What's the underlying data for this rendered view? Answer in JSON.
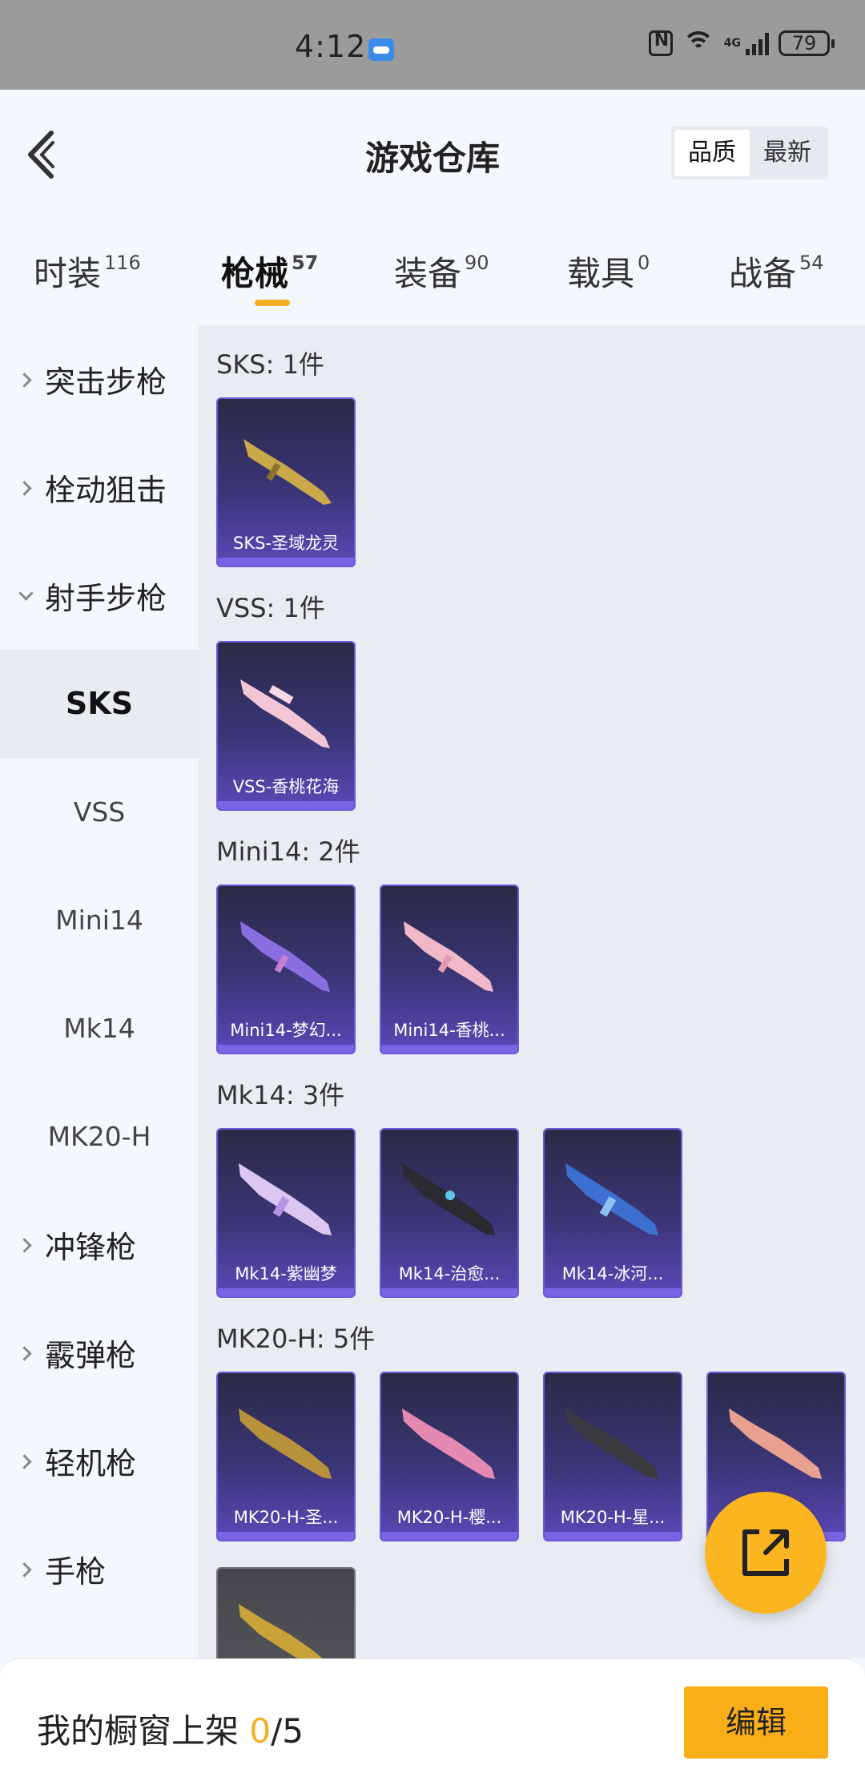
{
  "status_bar": {
    "time": "4:12",
    "network": "4G",
    "battery": "79"
  },
  "header": {
    "title": "游戏仓库",
    "sort_options": [
      "品质",
      "最新"
    ],
    "sort_active": "品质"
  },
  "tabs": [
    {
      "label": "时装",
      "count": "116"
    },
    {
      "label": "枪械",
      "count": "57"
    },
    {
      "label": "装备",
      "count": "90"
    },
    {
      "label": "载具",
      "count": "0"
    },
    {
      "label": "战备",
      "count": "54"
    }
  ],
  "active_tab": "枪械",
  "sidebar": {
    "categories": [
      "突击步枪",
      "栓动狙击",
      "射手步枪",
      "冲锋枪",
      "霰弹枪",
      "轻机枪",
      "手枪"
    ],
    "expanded_category": "射手步枪",
    "subcategories": [
      "SKS",
      "VSS",
      "Mini14",
      "Mk14",
      "MK20-H"
    ],
    "active_subcategory": "SKS"
  },
  "groups": [
    {
      "title": "SKS: 1件",
      "items": [
        "SKS-圣域龙灵"
      ]
    },
    {
      "title": "VSS: 1件",
      "items": [
        "VSS-香桃花海"
      ]
    },
    {
      "title": "Mini14: 2件",
      "items": [
        "Mini14-梦幻...",
        "Mini14-香桃..."
      ]
    },
    {
      "title": "Mk14: 3件",
      "items": [
        "Mk14-紫幽梦",
        "Mk14-治愈...",
        "Mk14-冰河..."
      ]
    },
    {
      "title": "MK20-H: 5件",
      "items": [
        "MK20-H-圣...",
        "MK20-H-樱...",
        "MK20-H-星...",
        "...",
        ""
      ]
    }
  ],
  "bottom": {
    "label": "我的橱窗上架 ",
    "current": "0",
    "total": "/5",
    "edit_label": "编辑"
  },
  "colors": {
    "accent": "#f3b021",
    "card_purple": "#5b48b8",
    "fab": "#fbb51f"
  },
  "icons": {
    "back": "chevron-left-icon",
    "fab": "share-external-icon"
  }
}
